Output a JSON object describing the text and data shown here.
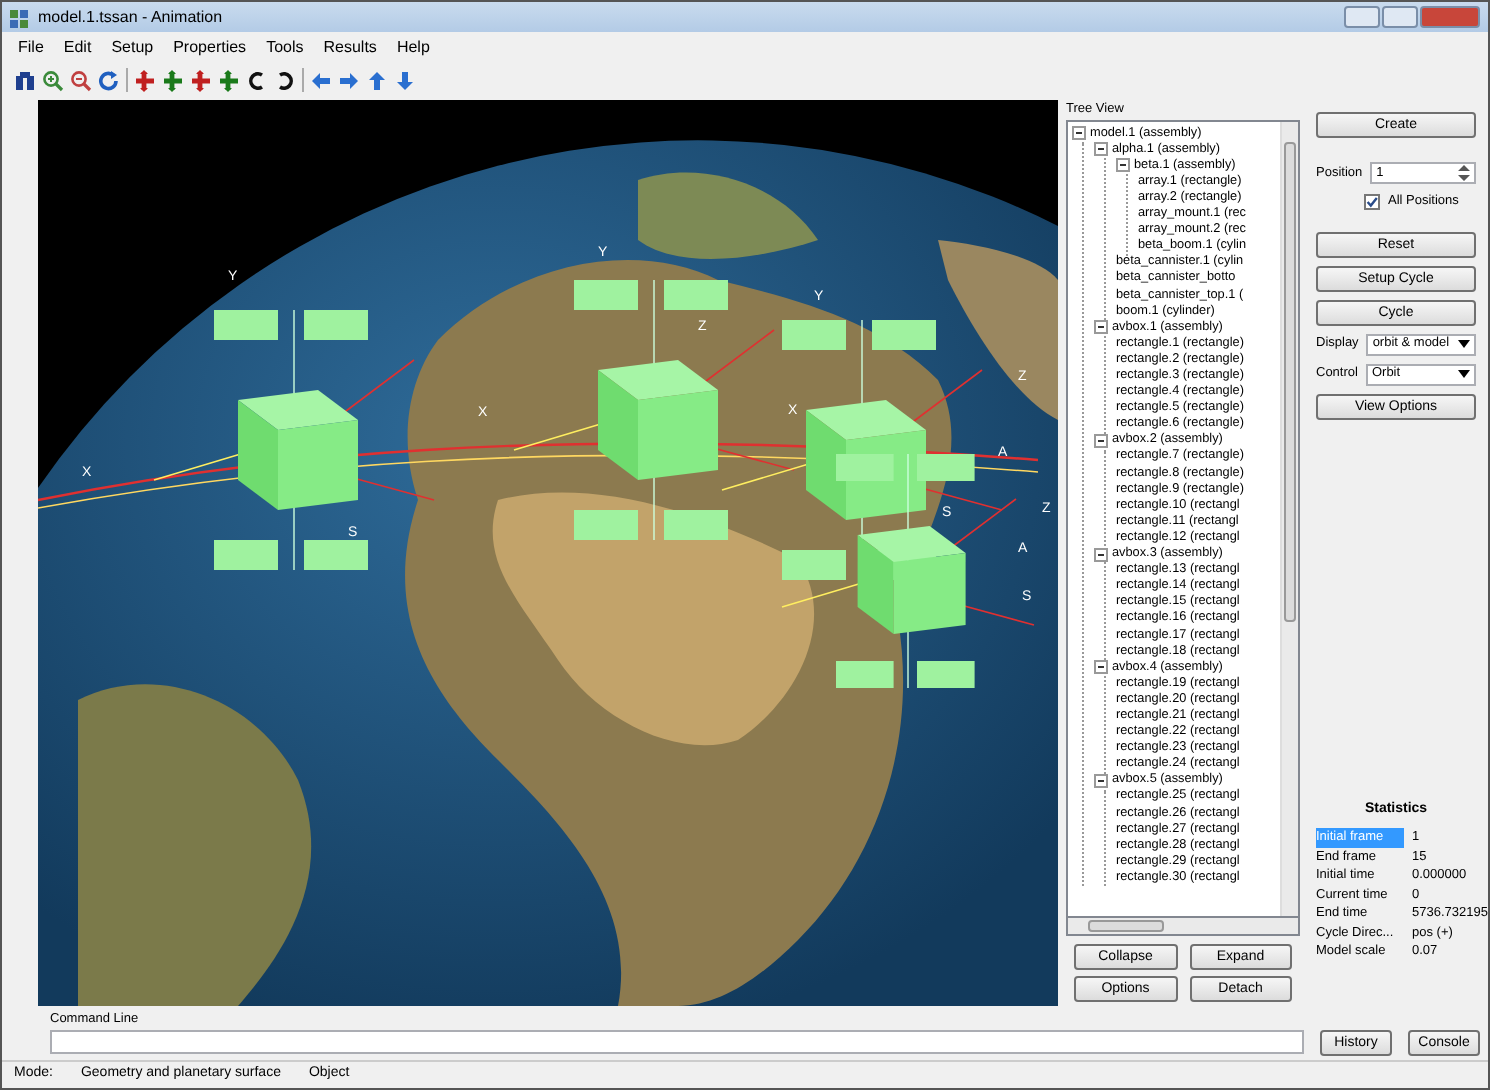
{
  "window": {
    "title": "model.1.tssan - Animation"
  },
  "menu": [
    "File",
    "Edit",
    "Setup",
    "Properties",
    "Tools",
    "Results",
    "Help"
  ],
  "viewport": {
    "axis_labels": [
      "Y",
      "Y",
      "Y",
      "Z",
      "Z",
      "Z",
      "X",
      "X",
      "X",
      "A",
      "A",
      "S",
      "S",
      "S"
    ]
  },
  "tree_view": {
    "title": "Tree View",
    "items": [
      {
        "label": "model.1 (assembly)",
        "expanded": true,
        "children": [
          {
            "label": "alpha.1 (assembly)",
            "expanded": true,
            "children": [
              {
                "label": "beta.1 (assembly)",
                "expanded": true,
                "children": [
                  {
                    "label": "array.1 (rectangle)"
                  },
                  {
                    "label": "array.2 (rectangle)"
                  },
                  {
                    "label": "array_mount.1 (rec"
                  },
                  {
                    "label": "array_mount.2 (rec"
                  },
                  {
                    "label": "beta_boom.1 (cylin"
                  }
                ]
              },
              {
                "label": "beta_cannister.1 (cylin"
              },
              {
                "label": "beta_cannister_botto"
              },
              {
                "label": "beta_cannister_top.1 ("
              },
              {
                "label": "boom.1 (cylinder)"
              }
            ]
          },
          {
            "label": "avbox.1 (assembly)",
            "expanded": true,
            "children": [
              {
                "label": "rectangle.1 (rectangle)"
              },
              {
                "label": "rectangle.2 (rectangle)"
              },
              {
                "label": "rectangle.3 (rectangle)"
              },
              {
                "label": "rectangle.4 (rectangle)"
              },
              {
                "label": "rectangle.5 (rectangle)"
              },
              {
                "label": "rectangle.6 (rectangle)"
              }
            ]
          },
          {
            "label": "avbox.2 (assembly)",
            "expanded": true,
            "children": [
              {
                "label": "rectangle.7 (rectangle)"
              },
              {
                "label": "rectangle.8 (rectangle)"
              },
              {
                "label": "rectangle.9 (rectangle)"
              },
              {
                "label": "rectangle.10 (rectangl"
              },
              {
                "label": "rectangle.11 (rectangl"
              },
              {
                "label": "rectangle.12 (rectangl"
              }
            ]
          },
          {
            "label": "avbox.3 (assembly)",
            "expanded": true,
            "children": [
              {
                "label": "rectangle.13 (rectangl"
              },
              {
                "label": "rectangle.14 (rectangl"
              },
              {
                "label": "rectangle.15 (rectangl"
              },
              {
                "label": "rectangle.16 (rectangl"
              },
              {
                "label": "rectangle.17 (rectangl"
              },
              {
                "label": "rectangle.18 (rectangl"
              }
            ]
          },
          {
            "label": "avbox.4 (assembly)",
            "expanded": true,
            "children": [
              {
                "label": "rectangle.19 (rectangl"
              },
              {
                "label": "rectangle.20 (rectangl"
              },
              {
                "label": "rectangle.21 (rectangl"
              },
              {
                "label": "rectangle.22 (rectangl"
              },
              {
                "label": "rectangle.23 (rectangl"
              },
              {
                "label": "rectangle.24 (rectangl"
              }
            ]
          },
          {
            "label": "avbox.5 (assembly)",
            "expanded": true,
            "children": [
              {
                "label": "rectangle.25 (rectangl"
              },
              {
                "label": "rectangle.26 (rectangl"
              },
              {
                "label": "rectangle.27 (rectangl"
              },
              {
                "label": "rectangle.28 (rectangl"
              },
              {
                "label": "rectangle.29 (rectangl"
              },
              {
                "label": "rectangle.30 (rectangl"
              }
            ]
          }
        ]
      }
    ]
  },
  "tree_buttons": [
    "Collapse",
    "Expand",
    "Options",
    "Detach"
  ],
  "controls": {
    "create": "Create",
    "position": {
      "label": "Position",
      "value": "1"
    },
    "all_positions": {
      "label": "All Positions",
      "checked": true
    },
    "buttons": [
      "Reset",
      "Setup Cycle",
      "Cycle"
    ],
    "display": {
      "label": "Display",
      "value": "orbit & model"
    },
    "control": {
      "label": "Control",
      "value": "Orbit"
    },
    "view_options": "View Options"
  },
  "statistics": {
    "title": "Statistics",
    "rows": [
      {
        "name": "Initial frame",
        "value": "1",
        "selected": true
      },
      {
        "name": "End frame",
        "value": "15",
        "selected": false
      },
      {
        "name": "Initial time",
        "value": "0.000000",
        "selected": false
      },
      {
        "name": "Current time",
        "value": "0",
        "selected": false
      },
      {
        "name": "End time",
        "value": "5736.732195",
        "selected": false
      },
      {
        "name": "Cycle Direc...",
        "value": "pos (+)",
        "selected": false
      },
      {
        "name": "Model scale",
        "value": "0.07",
        "selected": false
      }
    ]
  },
  "command_line": {
    "label": "Command Line",
    "buttons": [
      "History",
      "Console"
    ]
  },
  "status_bar": {
    "mode_label": "Mode:",
    "mode": "Geometry and planetary surface",
    "object": "Object"
  }
}
